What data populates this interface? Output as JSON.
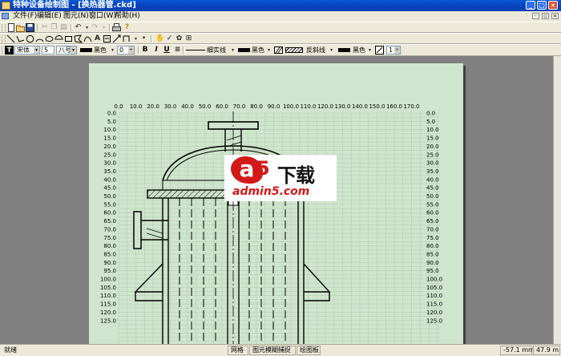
{
  "window": {
    "title": "特种设备绘制图 - [换热器管.ckd]",
    "controls": {
      "minimize": "_",
      "maximize": "□",
      "close": "×"
    }
  },
  "menu": [
    {
      "label": "文件(F)"
    },
    {
      "label": "编辑(E)"
    },
    {
      "label": "图元(N)"
    },
    {
      "label": "窗口(W)"
    },
    {
      "label": "帮助(H)"
    }
  ],
  "toolbar_standard": {
    "buttons": [
      "new-icon",
      "open-icon",
      "save-icon",
      "cut-icon",
      "copy-icon",
      "paste-icon",
      "undo-icon",
      "redo-icon",
      "print-icon",
      "help-icon"
    ]
  },
  "toolbar_draw": {
    "buttons": [
      "line-icon",
      "polyline-icon",
      "circle-icon",
      "arc-icon",
      "ellipse-icon",
      "semicircle-icon",
      "rectangle-icon",
      "polygon-icon",
      "curve-icon",
      "text-icon",
      "textbox-icon",
      "dimension-icon",
      "bracket-icon",
      "point-icon",
      "hand-icon",
      "check-icon",
      "flower-icon",
      "table-icon"
    ],
    "text_label": "A"
  },
  "toolbar_format": {
    "font": "宋体",
    "size_number": "5",
    "size_name": "八号",
    "text_color": "黑色",
    "value": "0",
    "bold": "B",
    "italic": "I",
    "underline": "U",
    "line_type": "细实线",
    "line_color": "黑色",
    "hatch": "反斜线",
    "hatch_color": "黑色",
    "scale": "1"
  },
  "drawing": {
    "x_ticks": [
      "0.0",
      "10.0",
      "20.0",
      "30.0",
      "40.0",
      "50.0",
      "60.0",
      "70.0",
      "80.0",
      "90.0",
      "100.0",
      "110.0",
      "120.0",
      "130.0",
      "140.0",
      "150.0",
      "160.0",
      "170.0"
    ],
    "y_ticks": [
      "0.0",
      "5.0",
      "10.0",
      "15.0",
      "20.0",
      "25.0",
      "30.0",
      "35.0",
      "40.0",
      "45.0",
      "50.0",
      "55.0",
      "60.0",
      "65.0",
      "70.0",
      "75.0",
      "80.0",
      "85.0",
      "90.0",
      "95.0",
      "100.0",
      "105.0",
      "110.0",
      "115.0",
      "120.0",
      "125.0"
    ],
    "grid_color": "#b3d0b0",
    "paper_color": "#cfe5cd"
  },
  "watermark": {
    "logo_a": "a",
    "logo_5": "5",
    "logo_text": "下载",
    "site": "admin5.com"
  },
  "status": {
    "ready": "就绪",
    "grid": "网格",
    "snap": "图元模糊捕捉",
    "board": "绘图板",
    "coord_x": "-57.1 mm",
    "coord_y": "47.9 m"
  }
}
